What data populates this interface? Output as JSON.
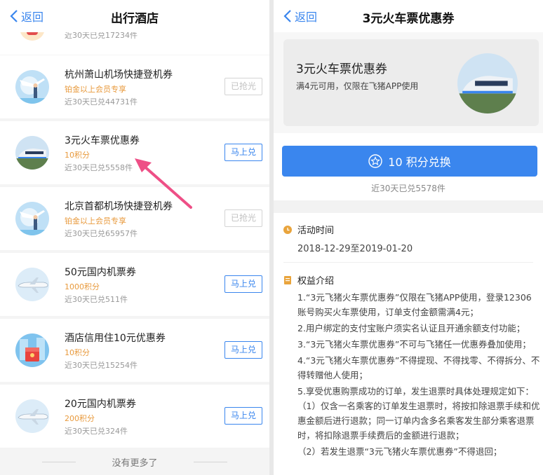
{
  "left": {
    "nav": {
      "back_label": "返回",
      "title": "出行酒店"
    },
    "partial_row_sub": "近30天已兑17234件",
    "items": [
      {
        "name": "杭州萧山机场快捷登机券",
        "points": "铂金以上会员专享",
        "sold": "近30天已兑44731件",
        "button": "已抢光",
        "icon": "plane-woman-icon"
      },
      {
        "name": "3元火车票优惠券",
        "points": "10积分",
        "sold": "近30天已兑5558件",
        "button": "马上兑",
        "icon": "train-icon"
      },
      {
        "name": "北京首都机场快捷登机券",
        "points": "铂金以上会员专享",
        "sold": "近30天已兑65957件",
        "button": "已抢光",
        "icon": "plane-woman-icon"
      },
      {
        "name": "50元国内机票券",
        "points": "1000积分",
        "sold": "近30天已兑511件",
        "button": "马上兑",
        "icon": "airplane-icon"
      },
      {
        "name": "酒店信用住10元优惠券",
        "points": "10积分",
        "sold": "近30天已兑15254件",
        "button": "马上兑",
        "icon": "hotel-coupon-icon"
      },
      {
        "name": "20元国内机票券",
        "points": "200积分",
        "sold": "近30天已兑324件",
        "button": "马上兑",
        "icon": "airplane-icon"
      }
    ],
    "footer": "没有更多了"
  },
  "right": {
    "nav": {
      "back_label": "返回",
      "title": "3元火车票优惠券"
    },
    "card": {
      "title": "3元火车票优惠券",
      "desc": "满4元可用，仅限在飞猪APP使用",
      "icon": "train-icon"
    },
    "exchange_button": "10 积分兑换",
    "sold": "近30天已兑5578件",
    "activity": {
      "heading": "活动时间",
      "range": "2018-12-29至2019-01-20"
    },
    "benefits": {
      "heading": "权益介绍",
      "rules": [
        "1.“3元飞猪火车票优惠券”仅限在飞猪APP使用，登录12306账号购买火车票使用，订单支付金额需满4元；",
        "2.用户绑定的支付宝账户须实名认证且开通余额支付功能；",
        "3.“3元飞猪火车票优惠券”不可与飞猪任一优惠券叠加使用；",
        "4.“3元飞猪火车票优惠券”不得提现、不得找零、不得拆分、不得转赠他人使用；",
        "5.享受优惠购票成功的订单，发生退票时具体处理规定如下：（1）仅含一名乘客的订单发生退票时，将按扣除退票手续和优惠金额后进行退款；同一订单内含多名乘客发生部分乘客退票时，将扣除退票手续费后的金额进行退款；",
        "（2）若发生退票“3元飞猪火车票优惠券”不得退回；"
      ]
    }
  },
  "colors": {
    "accent": "#3a86ee",
    "points": "#e89a3d",
    "arrow": "#ee4f86"
  }
}
